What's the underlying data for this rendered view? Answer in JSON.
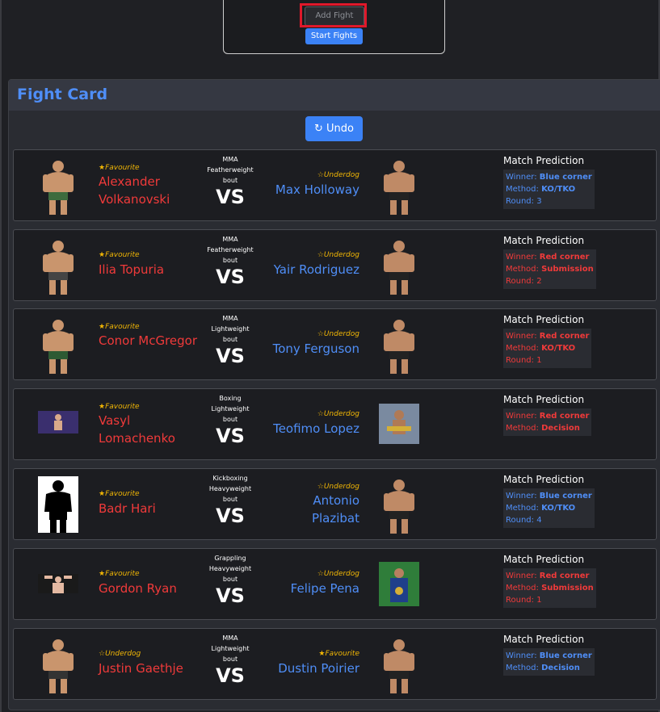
{
  "controls": {
    "add_fight_label": "Add Fight",
    "start_fights_label": "Start Fights"
  },
  "fight_card": {
    "title": "Fight Card",
    "undo_label": "Undo"
  },
  "prediction_heading": "Match Prediction",
  "fights": [
    {
      "bout_line1": "MMA",
      "bout_line2": "Featherweight",
      "bout_line3": "bout",
      "vs": "VS",
      "left_status": "Favourite",
      "left_name": "Alexander Volkanovski",
      "right_status": "Underdog",
      "right_name": "Max Holloway",
      "winner": "Blue corner",
      "method": "KO/TKO",
      "round": "Round: 3"
    },
    {
      "bout_line1": "MMA",
      "bout_line2": "Featherweight",
      "bout_line3": "bout",
      "vs": "VS",
      "left_status": "Favourite",
      "left_name": "Ilia Topuria",
      "right_status": "Underdog",
      "right_name": "Yair Rodriguez",
      "winner": "Red corner",
      "method": "Submission",
      "round": "Round: 2"
    },
    {
      "bout_line1": "MMA",
      "bout_line2": "Lightweight",
      "bout_line3": "bout",
      "vs": "VS",
      "left_status": "Favourite",
      "left_name": "Conor McGregor",
      "right_status": "Underdog",
      "right_name": "Tony Ferguson",
      "winner": "Red corner",
      "method": "KO/TKO",
      "round": "Round: 1"
    },
    {
      "bout_line1": "Boxing",
      "bout_line2": "Lightweight",
      "bout_line3": "bout",
      "vs": "VS",
      "left_status": "Favourite",
      "left_name": "Vasyl Lomachenko",
      "right_status": "Underdog",
      "right_name": "Teofimo Lopez",
      "winner": "Red corner",
      "method": "Decision",
      "round": ""
    },
    {
      "bout_line1": "Kickboxing",
      "bout_line2": "Heavyweight",
      "bout_line3": "bout",
      "vs": "VS",
      "left_status": "Favourite",
      "left_name": "Badr Hari",
      "right_status": "Underdog",
      "right_name": "Antonio Plazibat",
      "winner": "Blue corner",
      "method": "KO/TKO",
      "round": "Round: 4"
    },
    {
      "bout_line1": "Grappling",
      "bout_line2": "Heavyweight",
      "bout_line3": "bout",
      "vs": "VS",
      "left_status": "Favourite",
      "left_name": "Gordon Ryan",
      "right_status": "Underdog",
      "right_name": "Felipe Pena",
      "winner": "Red corner",
      "method": "Submission",
      "round": "Round: 1"
    },
    {
      "bout_line1": "MMA",
      "bout_line2": "Lightweight",
      "bout_line3": "bout",
      "vs": "VS",
      "left_status": "Underdog",
      "left_name": "Justin Gaethje",
      "right_status": "Favourite",
      "right_name": "Dustin Poirier",
      "winner": "Blue corner",
      "method": "Decision",
      "round": ""
    }
  ],
  "labels": {
    "winner": "Winner:",
    "method": "Method:"
  },
  "colors": {
    "red_corner": "#f03a3a",
    "blue_corner": "#4f8ef7",
    "accent": "#3b82f6",
    "favourite_star": "#f2b705"
  }
}
